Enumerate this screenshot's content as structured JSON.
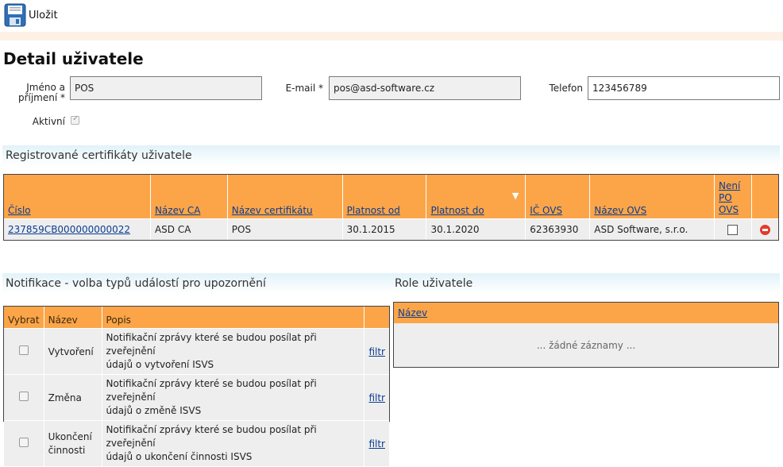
{
  "toolbar": {
    "save_label": "Uložit",
    "save_icon": "floppy-disk-icon"
  },
  "page": {
    "title": "Detail uživatele"
  },
  "form": {
    "name_label_line1": "Jméno a",
    "name_label_line2": "příjmení *",
    "name_value": "POS",
    "email_label": "E-mail *",
    "email_value": "pos@asd-software.cz",
    "phone_label": "Telefon",
    "phone_value": "123456789",
    "active_label": "Aktivní",
    "active_checked": true
  },
  "certificates": {
    "section_title": "Registrované certifikáty uživatele",
    "headers": {
      "cislo": "Číslo",
      "nazev_ca": "Název CA",
      "nazev_cert": "Název certifikátu",
      "platnost_od": "Platnost od",
      "platnost_do": "Platnost do",
      "sort_indicator": "▼",
      "ic_ovs": "IČ OVS",
      "nazev_ovs": "Název OVS",
      "neni_po_ovs_1": "Není",
      "neni_po_ovs_2": "PO",
      "neni_po_ovs_3": "OVS"
    },
    "rows": [
      {
        "cislo": "237859CB000000000022",
        "nazev_ca": "ASD CA",
        "nazev_cert": "POS",
        "platnost_od": "30.1.2015",
        "platnost_do": "30.1.2020",
        "ic_ovs": "62363930",
        "nazev_ovs": "ASD Software, s.r.o."
      }
    ]
  },
  "notifications": {
    "section_title": "Notifikace - volba typů událostí pro upozornění",
    "headers": {
      "vybrat": "Vybrat",
      "nazev": "Název",
      "popis": "Popis"
    },
    "rows": [
      {
        "nazev": "Vytvoření",
        "popis1": "Notifikační zprávy které se budou posílat při zveřejnění",
        "popis2": "údajů o vytvoření ISVS",
        "filter": "filtr"
      },
      {
        "nazev": "Změna",
        "popis1": "Notifikační zprávy které se budou posílat při zveřejnění",
        "popis2": "údajů o změně ISVS",
        "filter": "filtr"
      },
      {
        "nazev1": "Ukončení",
        "nazev2": "činnosti",
        "popis1": "Notifikační zprávy které se budou posílat při zveřejnění",
        "popis2": "údajů o ukončení činnosti ISVS",
        "filter": "filtr"
      }
    ]
  },
  "roles": {
    "section_title": "Role uživatele",
    "header": "Název",
    "empty": "... žádné záznamy ..."
  }
}
